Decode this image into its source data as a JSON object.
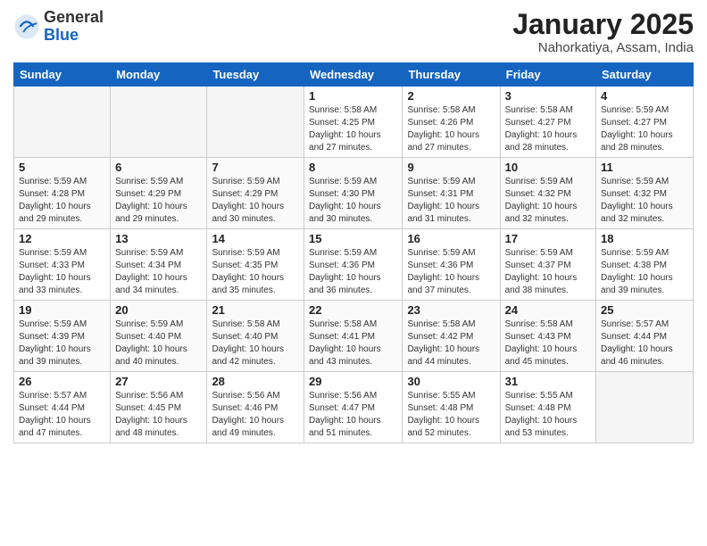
{
  "logo": {
    "general": "General",
    "blue": "Blue"
  },
  "header": {
    "title": "January 2025",
    "subtitle": "Nahorkatiya, Assam, India"
  },
  "weekdays": [
    "Sunday",
    "Monday",
    "Tuesday",
    "Wednesday",
    "Thursday",
    "Friday",
    "Saturday"
  ],
  "weeks": [
    [
      {
        "day": "",
        "sunrise": "",
        "sunset": "",
        "daylight": ""
      },
      {
        "day": "",
        "sunrise": "",
        "sunset": "",
        "daylight": ""
      },
      {
        "day": "",
        "sunrise": "",
        "sunset": "",
        "daylight": ""
      },
      {
        "day": "1",
        "sunrise": "Sunrise: 5:58 AM",
        "sunset": "Sunset: 4:25 PM",
        "daylight": "Daylight: 10 hours and 27 minutes."
      },
      {
        "day": "2",
        "sunrise": "Sunrise: 5:58 AM",
        "sunset": "Sunset: 4:26 PM",
        "daylight": "Daylight: 10 hours and 27 minutes."
      },
      {
        "day": "3",
        "sunrise": "Sunrise: 5:58 AM",
        "sunset": "Sunset: 4:27 PM",
        "daylight": "Daylight: 10 hours and 28 minutes."
      },
      {
        "day": "4",
        "sunrise": "Sunrise: 5:59 AM",
        "sunset": "Sunset: 4:27 PM",
        "daylight": "Daylight: 10 hours and 28 minutes."
      }
    ],
    [
      {
        "day": "5",
        "sunrise": "Sunrise: 5:59 AM",
        "sunset": "Sunset: 4:28 PM",
        "daylight": "Daylight: 10 hours and 29 minutes."
      },
      {
        "day": "6",
        "sunrise": "Sunrise: 5:59 AM",
        "sunset": "Sunset: 4:29 PM",
        "daylight": "Daylight: 10 hours and 29 minutes."
      },
      {
        "day": "7",
        "sunrise": "Sunrise: 5:59 AM",
        "sunset": "Sunset: 4:29 PM",
        "daylight": "Daylight: 10 hours and 30 minutes."
      },
      {
        "day": "8",
        "sunrise": "Sunrise: 5:59 AM",
        "sunset": "Sunset: 4:30 PM",
        "daylight": "Daylight: 10 hours and 30 minutes."
      },
      {
        "day": "9",
        "sunrise": "Sunrise: 5:59 AM",
        "sunset": "Sunset: 4:31 PM",
        "daylight": "Daylight: 10 hours and 31 minutes."
      },
      {
        "day": "10",
        "sunrise": "Sunrise: 5:59 AM",
        "sunset": "Sunset: 4:32 PM",
        "daylight": "Daylight: 10 hours and 32 minutes."
      },
      {
        "day": "11",
        "sunrise": "Sunrise: 5:59 AM",
        "sunset": "Sunset: 4:32 PM",
        "daylight": "Daylight: 10 hours and 32 minutes."
      }
    ],
    [
      {
        "day": "12",
        "sunrise": "Sunrise: 5:59 AM",
        "sunset": "Sunset: 4:33 PM",
        "daylight": "Daylight: 10 hours and 33 minutes."
      },
      {
        "day": "13",
        "sunrise": "Sunrise: 5:59 AM",
        "sunset": "Sunset: 4:34 PM",
        "daylight": "Daylight: 10 hours and 34 minutes."
      },
      {
        "day": "14",
        "sunrise": "Sunrise: 5:59 AM",
        "sunset": "Sunset: 4:35 PM",
        "daylight": "Daylight: 10 hours and 35 minutes."
      },
      {
        "day": "15",
        "sunrise": "Sunrise: 5:59 AM",
        "sunset": "Sunset: 4:36 PM",
        "daylight": "Daylight: 10 hours and 36 minutes."
      },
      {
        "day": "16",
        "sunrise": "Sunrise: 5:59 AM",
        "sunset": "Sunset: 4:36 PM",
        "daylight": "Daylight: 10 hours and 37 minutes."
      },
      {
        "day": "17",
        "sunrise": "Sunrise: 5:59 AM",
        "sunset": "Sunset: 4:37 PM",
        "daylight": "Daylight: 10 hours and 38 minutes."
      },
      {
        "day": "18",
        "sunrise": "Sunrise: 5:59 AM",
        "sunset": "Sunset: 4:38 PM",
        "daylight": "Daylight: 10 hours and 39 minutes."
      }
    ],
    [
      {
        "day": "19",
        "sunrise": "Sunrise: 5:59 AM",
        "sunset": "Sunset: 4:39 PM",
        "daylight": "Daylight: 10 hours and 39 minutes."
      },
      {
        "day": "20",
        "sunrise": "Sunrise: 5:59 AM",
        "sunset": "Sunset: 4:40 PM",
        "daylight": "Daylight: 10 hours and 40 minutes."
      },
      {
        "day": "21",
        "sunrise": "Sunrise: 5:58 AM",
        "sunset": "Sunset: 4:40 PM",
        "daylight": "Daylight: 10 hours and 42 minutes."
      },
      {
        "day": "22",
        "sunrise": "Sunrise: 5:58 AM",
        "sunset": "Sunset: 4:41 PM",
        "daylight": "Daylight: 10 hours and 43 minutes."
      },
      {
        "day": "23",
        "sunrise": "Sunrise: 5:58 AM",
        "sunset": "Sunset: 4:42 PM",
        "daylight": "Daylight: 10 hours and 44 minutes."
      },
      {
        "day": "24",
        "sunrise": "Sunrise: 5:58 AM",
        "sunset": "Sunset: 4:43 PM",
        "daylight": "Daylight: 10 hours and 45 minutes."
      },
      {
        "day": "25",
        "sunrise": "Sunrise: 5:57 AM",
        "sunset": "Sunset: 4:44 PM",
        "daylight": "Daylight: 10 hours and 46 minutes."
      }
    ],
    [
      {
        "day": "26",
        "sunrise": "Sunrise: 5:57 AM",
        "sunset": "Sunset: 4:44 PM",
        "daylight": "Daylight: 10 hours and 47 minutes."
      },
      {
        "day": "27",
        "sunrise": "Sunrise: 5:56 AM",
        "sunset": "Sunset: 4:45 PM",
        "daylight": "Daylight: 10 hours and 48 minutes."
      },
      {
        "day": "28",
        "sunrise": "Sunrise: 5:56 AM",
        "sunset": "Sunset: 4:46 PM",
        "daylight": "Daylight: 10 hours and 49 minutes."
      },
      {
        "day": "29",
        "sunrise": "Sunrise: 5:56 AM",
        "sunset": "Sunset: 4:47 PM",
        "daylight": "Daylight: 10 hours and 51 minutes."
      },
      {
        "day": "30",
        "sunrise": "Sunrise: 5:55 AM",
        "sunset": "Sunset: 4:48 PM",
        "daylight": "Daylight: 10 hours and 52 minutes."
      },
      {
        "day": "31",
        "sunrise": "Sunrise: 5:55 AM",
        "sunset": "Sunset: 4:48 PM",
        "daylight": "Daylight: 10 hours and 53 minutes."
      },
      {
        "day": "",
        "sunrise": "",
        "sunset": "",
        "daylight": ""
      }
    ]
  ]
}
